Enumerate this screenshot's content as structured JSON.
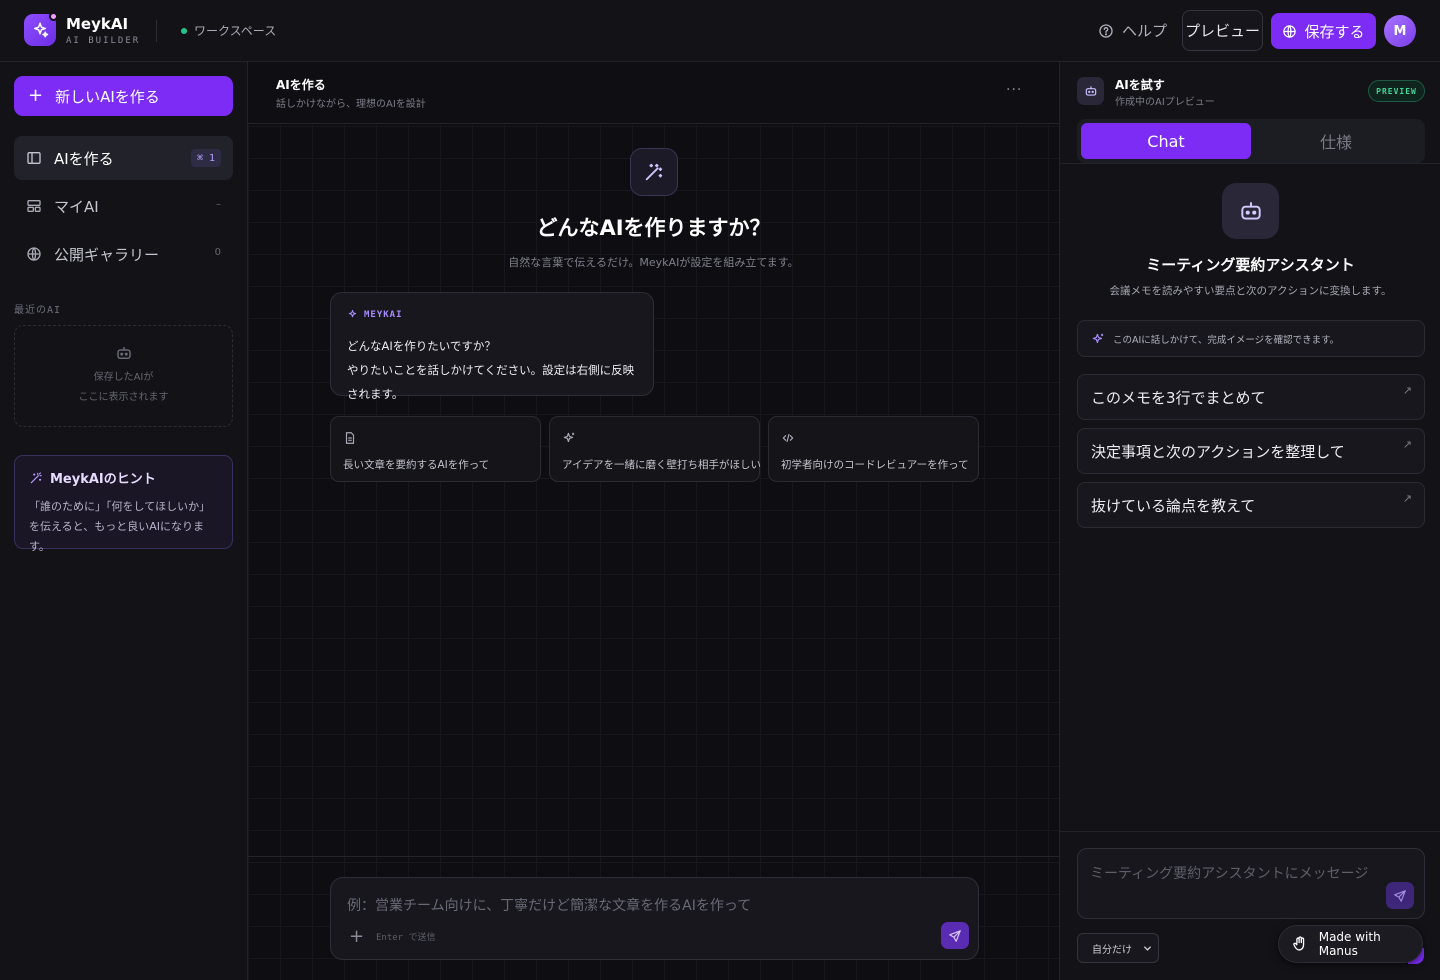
{
  "header": {
    "brand": "MeykAI",
    "brand_sub": "AI BUILDER",
    "workspace": "ワークスペース",
    "help": "ヘルプ",
    "preview": "プレビュー",
    "save": "保存する",
    "avatar": "M"
  },
  "sidebar": {
    "new_ai": "新しいAIを作る",
    "items": [
      {
        "label": "AIを作る",
        "badge": "⌘ 1",
        "icon": "layout-icon",
        "active": true
      },
      {
        "label": "マイAI",
        "count": "–",
        "icon": "grid-icon"
      },
      {
        "label": "公開ギャラリー",
        "count": "0",
        "icon": "globe-icon"
      }
    ],
    "recent_title": "最近のAI",
    "recent_empty_line1": "保存したAIが",
    "recent_empty_line2": "ここに表示されます",
    "tip_title": "MeykAIのヒント",
    "tip_text": "「誰のために」「何をしてほしいか」を伝えると、もっと良いAIになります。"
  },
  "center": {
    "title": "AIを作る",
    "subtitle": "話しかけながら、理想のAIを設計",
    "more": "···",
    "hero_title": "どんなAIを作りますか？",
    "hero_sub": "自然な言葉で伝えるだけ。MeykAIが設定を組み立てます。",
    "bubble_tag": "MEYKAI",
    "bubble_line1": "どんなAIを作りたいですか？",
    "bubble_line2": "やりたいことを話しかけてください。設定は右側に反映されます。",
    "suggestions": [
      {
        "text": "長い文章を要約するAIを作って",
        "icon": "document-icon"
      },
      {
        "text": "アイデアを一緒に磨く壁打ち相手がほしい",
        "icon": "sparkle-icon"
      },
      {
        "text": "初学者向けのコードレビュアーを作って",
        "icon": "code-icon"
      }
    ],
    "composer_placeholder": "例：営業チーム向けに、丁寧だけど簡潔な文章を作るAIを作って",
    "composer_hint": "Enter で送信"
  },
  "preview": {
    "title": "AIを試す",
    "subtitle": "作成中のAIプレビュー",
    "badge": "PREVIEW",
    "tabs": [
      "Chat",
      "仕様"
    ],
    "bot_name": "ミーティング要約アシスタント",
    "bot_desc": "会議メモを読みやすい要点と次のアクションに変換します。",
    "info": "このAIに話しかけて、完成イメージを確認できます。",
    "prompts": [
      "このメモを3行でまとめて",
      "決定事項と次のアクションを整理して",
      "抜けている論点を教えて"
    ],
    "chat_placeholder": "ミーティング要約アシスタントにメッセージ",
    "scope": "自分だけ"
  },
  "badge_manus": "Made with Manus",
  "colors": {
    "accent": "#7c2cf5",
    "background": "#0f0f13",
    "panel": "#121217",
    "success": "#22c58b"
  }
}
